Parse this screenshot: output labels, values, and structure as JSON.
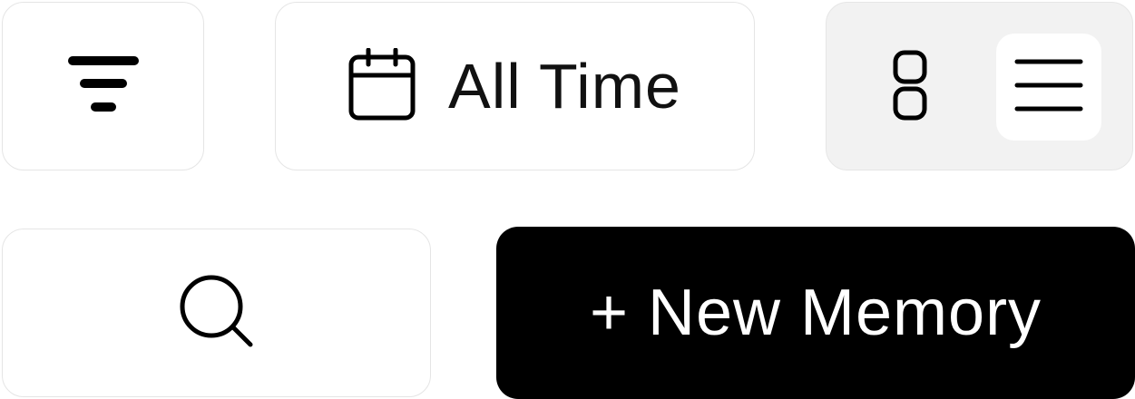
{
  "toolbar": {
    "filter_icon": "filter-icon",
    "date_range": {
      "icon": "calendar-icon",
      "label": "All Time"
    },
    "view_toggle": {
      "options": [
        {
          "icon": "grid-view-icon",
          "selected": false
        },
        {
          "icon": "list-view-icon",
          "selected": true
        }
      ],
      "selected_background": "#ffffff",
      "track_background": "#f2f2f2"
    },
    "search_icon": "search-icon",
    "new_memory": {
      "label": "+ New Memory",
      "background": "#000000",
      "text_color": "#ffffff"
    }
  }
}
